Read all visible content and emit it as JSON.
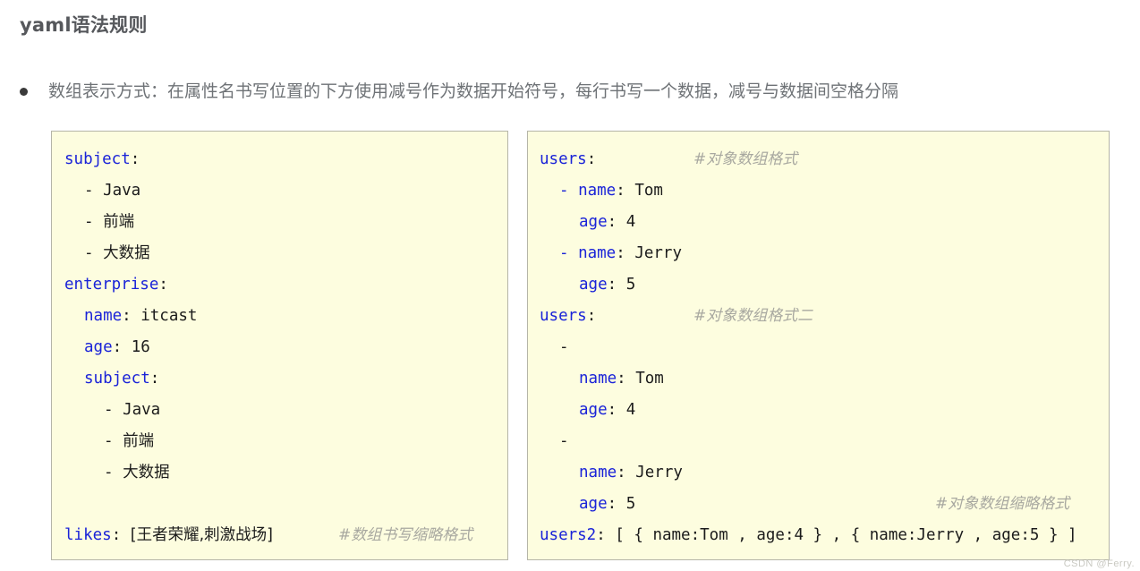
{
  "page": {
    "title": "yaml语法规则",
    "watermark": "CSDN @Ferry."
  },
  "bullet": {
    "marker": "bullet-dot",
    "text": "数组表示方式：在属性名书写位置的下方使用减号作为数据开始符号，每行书写一个数据，减号与数据间空格分隔"
  },
  "colors": {
    "code_background": "#fdfddf",
    "code_border": "#b5b5a8",
    "key_blue": "#1a23d8",
    "value_dark": "#1b1b1b",
    "comment_gray": "#a8a8a0",
    "title_gray": "#56585c",
    "body_gray": "#6e7276"
  },
  "left_panel": {
    "name": "yaml-array-basic-example",
    "lines": [
      {
        "indent": 0,
        "key": "subject",
        "colon": ":",
        "value": ""
      },
      {
        "indent": 1,
        "dash": "- ",
        "value": "Java"
      },
      {
        "indent": 1,
        "dash": "- ",
        "value": "前端"
      },
      {
        "indent": 1,
        "dash": "- ",
        "value": "大数据"
      },
      {
        "indent": 0,
        "key": "enterprise",
        "colon": ":",
        "value": ""
      },
      {
        "indent": 1,
        "key": "name",
        "colon": ": ",
        "value": "itcast"
      },
      {
        "indent": 1,
        "key": "age",
        "colon": ": ",
        "value": "16"
      },
      {
        "indent": 1,
        "key": "subject",
        "colon": ":",
        "value": ""
      },
      {
        "indent": 2,
        "dash": "- ",
        "value": "Java"
      },
      {
        "indent": 2,
        "dash": "- ",
        "value": "前端"
      },
      {
        "indent": 2,
        "dash": "- ",
        "value": "大数据"
      },
      {
        "indent": 0,
        "blank": true
      },
      {
        "indent": 0,
        "key": "likes",
        "colon": ": ",
        "value": "[王者荣耀,刺激战场]",
        "comment": "#数组书写缩略格式"
      }
    ]
  },
  "right_panel": {
    "name": "yaml-object-array-example",
    "lines": [
      {
        "indent": 0,
        "key": "users",
        "colon": ":",
        "value": "",
        "comment": "#对象数组格式"
      },
      {
        "indent": 1,
        "dash": "- ",
        "key": "name",
        "colon": ": ",
        "value": "Tom"
      },
      {
        "indent": 2,
        "key": "age",
        "colon": ": ",
        "value": "4"
      },
      {
        "indent": 1,
        "dash": "- ",
        "key": "name",
        "colon": ": ",
        "value": "Jerry"
      },
      {
        "indent": 2,
        "key": "age",
        "colon": ": ",
        "value": "5"
      },
      {
        "indent": 0,
        "key": "users",
        "colon": ":",
        "value": "",
        "comment": "#对象数组格式二"
      },
      {
        "indent": 1,
        "dash": "-",
        "value": ""
      },
      {
        "indent": 2,
        "key": "name",
        "colon": ": ",
        "value": "Tom"
      },
      {
        "indent": 2,
        "key": "age",
        "colon": ": ",
        "value": "4"
      },
      {
        "indent": 1,
        "dash": "-",
        "value": ""
      },
      {
        "indent": 2,
        "key": "name",
        "colon": ": ",
        "value": "Jerry"
      },
      {
        "indent": 2,
        "key": "age",
        "colon": ": ",
        "value": "5",
        "comment": "#对象数组缩略格式"
      },
      {
        "indent": 0,
        "key": "users2",
        "colon": ": ",
        "value": "[ { name:Tom , age:4 } , { name:Jerry , age:5 } ]"
      }
    ]
  }
}
